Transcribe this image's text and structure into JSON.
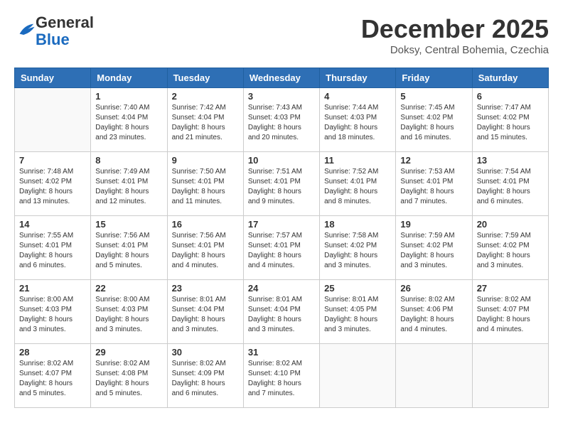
{
  "header": {
    "logo_line1": "General",
    "logo_line2": "Blue",
    "month_title": "December 2025",
    "location": "Doksy, Central Bohemia, Czechia"
  },
  "days_of_week": [
    "Sunday",
    "Monday",
    "Tuesday",
    "Wednesday",
    "Thursday",
    "Friday",
    "Saturday"
  ],
  "weeks": [
    [
      {
        "day": "",
        "info": ""
      },
      {
        "day": "1",
        "info": "Sunrise: 7:40 AM\nSunset: 4:04 PM\nDaylight: 8 hours\nand 23 minutes."
      },
      {
        "day": "2",
        "info": "Sunrise: 7:42 AM\nSunset: 4:04 PM\nDaylight: 8 hours\nand 21 minutes."
      },
      {
        "day": "3",
        "info": "Sunrise: 7:43 AM\nSunset: 4:03 PM\nDaylight: 8 hours\nand 20 minutes."
      },
      {
        "day": "4",
        "info": "Sunrise: 7:44 AM\nSunset: 4:03 PM\nDaylight: 8 hours\nand 18 minutes."
      },
      {
        "day": "5",
        "info": "Sunrise: 7:45 AM\nSunset: 4:02 PM\nDaylight: 8 hours\nand 16 minutes."
      },
      {
        "day": "6",
        "info": "Sunrise: 7:47 AM\nSunset: 4:02 PM\nDaylight: 8 hours\nand 15 minutes."
      }
    ],
    [
      {
        "day": "7",
        "info": "Sunrise: 7:48 AM\nSunset: 4:02 PM\nDaylight: 8 hours\nand 13 minutes."
      },
      {
        "day": "8",
        "info": "Sunrise: 7:49 AM\nSunset: 4:01 PM\nDaylight: 8 hours\nand 12 minutes."
      },
      {
        "day": "9",
        "info": "Sunrise: 7:50 AM\nSunset: 4:01 PM\nDaylight: 8 hours\nand 11 minutes."
      },
      {
        "day": "10",
        "info": "Sunrise: 7:51 AM\nSunset: 4:01 PM\nDaylight: 8 hours\nand 9 minutes."
      },
      {
        "day": "11",
        "info": "Sunrise: 7:52 AM\nSunset: 4:01 PM\nDaylight: 8 hours\nand 8 minutes."
      },
      {
        "day": "12",
        "info": "Sunrise: 7:53 AM\nSunset: 4:01 PM\nDaylight: 8 hours\nand 7 minutes."
      },
      {
        "day": "13",
        "info": "Sunrise: 7:54 AM\nSunset: 4:01 PM\nDaylight: 8 hours\nand 6 minutes."
      }
    ],
    [
      {
        "day": "14",
        "info": "Sunrise: 7:55 AM\nSunset: 4:01 PM\nDaylight: 8 hours\nand 6 minutes."
      },
      {
        "day": "15",
        "info": "Sunrise: 7:56 AM\nSunset: 4:01 PM\nDaylight: 8 hours\nand 5 minutes."
      },
      {
        "day": "16",
        "info": "Sunrise: 7:56 AM\nSunset: 4:01 PM\nDaylight: 8 hours\nand 4 minutes."
      },
      {
        "day": "17",
        "info": "Sunrise: 7:57 AM\nSunset: 4:01 PM\nDaylight: 8 hours\nand 4 minutes."
      },
      {
        "day": "18",
        "info": "Sunrise: 7:58 AM\nSunset: 4:02 PM\nDaylight: 8 hours\nand 3 minutes."
      },
      {
        "day": "19",
        "info": "Sunrise: 7:59 AM\nSunset: 4:02 PM\nDaylight: 8 hours\nand 3 minutes."
      },
      {
        "day": "20",
        "info": "Sunrise: 7:59 AM\nSunset: 4:02 PM\nDaylight: 8 hours\nand 3 minutes."
      }
    ],
    [
      {
        "day": "21",
        "info": "Sunrise: 8:00 AM\nSunset: 4:03 PM\nDaylight: 8 hours\nand 3 minutes."
      },
      {
        "day": "22",
        "info": "Sunrise: 8:00 AM\nSunset: 4:03 PM\nDaylight: 8 hours\nand 3 minutes."
      },
      {
        "day": "23",
        "info": "Sunrise: 8:01 AM\nSunset: 4:04 PM\nDaylight: 8 hours\nand 3 minutes."
      },
      {
        "day": "24",
        "info": "Sunrise: 8:01 AM\nSunset: 4:04 PM\nDaylight: 8 hours\nand 3 minutes."
      },
      {
        "day": "25",
        "info": "Sunrise: 8:01 AM\nSunset: 4:05 PM\nDaylight: 8 hours\nand 3 minutes."
      },
      {
        "day": "26",
        "info": "Sunrise: 8:02 AM\nSunset: 4:06 PM\nDaylight: 8 hours\nand 4 minutes."
      },
      {
        "day": "27",
        "info": "Sunrise: 8:02 AM\nSunset: 4:07 PM\nDaylight: 8 hours\nand 4 minutes."
      }
    ],
    [
      {
        "day": "28",
        "info": "Sunrise: 8:02 AM\nSunset: 4:07 PM\nDaylight: 8 hours\nand 5 minutes."
      },
      {
        "day": "29",
        "info": "Sunrise: 8:02 AM\nSunset: 4:08 PM\nDaylight: 8 hours\nand 5 minutes."
      },
      {
        "day": "30",
        "info": "Sunrise: 8:02 AM\nSunset: 4:09 PM\nDaylight: 8 hours\nand 6 minutes."
      },
      {
        "day": "31",
        "info": "Sunrise: 8:02 AM\nSunset: 4:10 PM\nDaylight: 8 hours\nand 7 minutes."
      },
      {
        "day": "",
        "info": ""
      },
      {
        "day": "",
        "info": ""
      },
      {
        "day": "",
        "info": ""
      }
    ]
  ]
}
